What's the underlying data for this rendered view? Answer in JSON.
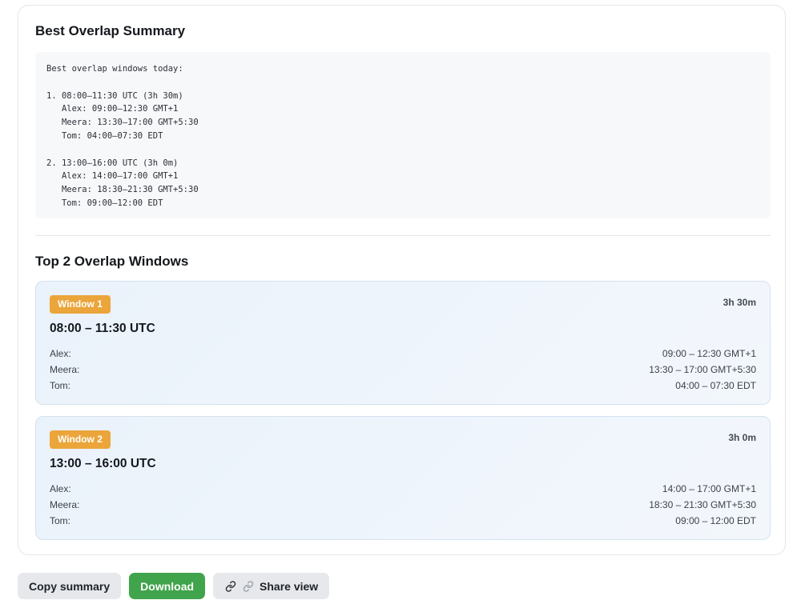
{
  "summary": {
    "title": "Best Overlap Summary",
    "text": "Best overlap windows today:\n\n1. 08:00–11:30 UTC (3h 30m)\n   Alex: 09:00–12:30 GMT+1\n   Meera: 13:30–17:00 GMT+5:30\n   Tom: 04:00–07:30 EDT\n\n2. 13:00–16:00 UTC (3h 0m)\n   Alex: 14:00–17:00 GMT+1\n   Meera: 18:30–21:30 GMT+5:30\n   Tom: 09:00–12:00 EDT"
  },
  "windows": {
    "title": "Top 2 Overlap Windows",
    "items": [
      {
        "badge": "Window 1",
        "duration": "3h 30m",
        "range": "08:00 – 11:30 UTC",
        "people": [
          {
            "name": "Alex:",
            "time": "09:00 – 12:30 GMT+1"
          },
          {
            "name": "Meera:",
            "time": "13:30 – 17:00 GMT+5:30"
          },
          {
            "name": "Tom:",
            "time": "04:00 – 07:30 EDT"
          }
        ]
      },
      {
        "badge": "Window 2",
        "duration": "3h 0m",
        "range": "13:00 – 16:00 UTC",
        "people": [
          {
            "name": "Alex:",
            "time": "14:00 – 17:00 GMT+1"
          },
          {
            "name": "Meera:",
            "time": "18:30 – 21:30 GMT+5:30"
          },
          {
            "name": "Tom:",
            "time": "09:00 – 12:00 EDT"
          }
        ]
      }
    ]
  },
  "actions": {
    "copy_label": "Copy summary",
    "download_label": "Download",
    "share_label": "Share view",
    "share_icons": [
      "link-icon",
      "link-icon"
    ]
  },
  "colors": {
    "badge": "#eba53a",
    "download": "#3fa44b",
    "card_border": "#d4e2f0"
  }
}
